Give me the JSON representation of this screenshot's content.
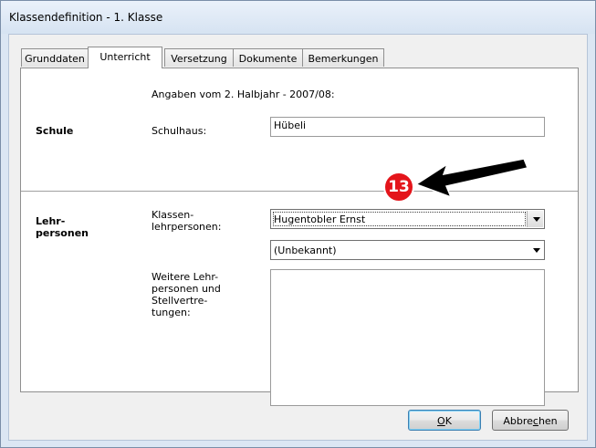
{
  "window": {
    "title": "Klassendefinition - 1. Klasse"
  },
  "tabs": [
    {
      "label": "Grunddaten",
      "active": false
    },
    {
      "label": "Unterricht",
      "active": true
    },
    {
      "label": "Versetzung",
      "active": false
    },
    {
      "label": "Dokumente",
      "active": false
    },
    {
      "label": "Bemerkungen",
      "active": false
    }
  ],
  "schule": {
    "section_label": "Schule",
    "info_text": "Angaben vom 2. Halbjahr - 2007/08:",
    "schulhaus_label": "Schulhaus:",
    "schulhaus_value": "Hübeli"
  },
  "lehrpersonen": {
    "section_label_line1": "Lehr-",
    "section_label_line2": "personen",
    "klassen_label_line1": "Klassen-",
    "klassen_label_line2": "lehrpersonen:",
    "klassenlehrperson_1": "Hugentobler Ernst",
    "klassenlehrperson_2": "(Unbekannt)",
    "weitere_label_line1": "Weitere Lehr-",
    "weitere_label_line2": "personen und",
    "weitere_label_line3": "Stellvertre-",
    "weitere_label_line4": "tungen:",
    "weitere_value": ""
  },
  "buttons": {
    "ok_prefix": "",
    "ok_underlined": "O",
    "ok_suffix": "K",
    "cancel_prefix": "Abbre",
    "cancel_underlined": "c",
    "cancel_suffix": "hen"
  },
  "annotation": {
    "badge_number": "13",
    "badge_color": "#e4151b"
  }
}
